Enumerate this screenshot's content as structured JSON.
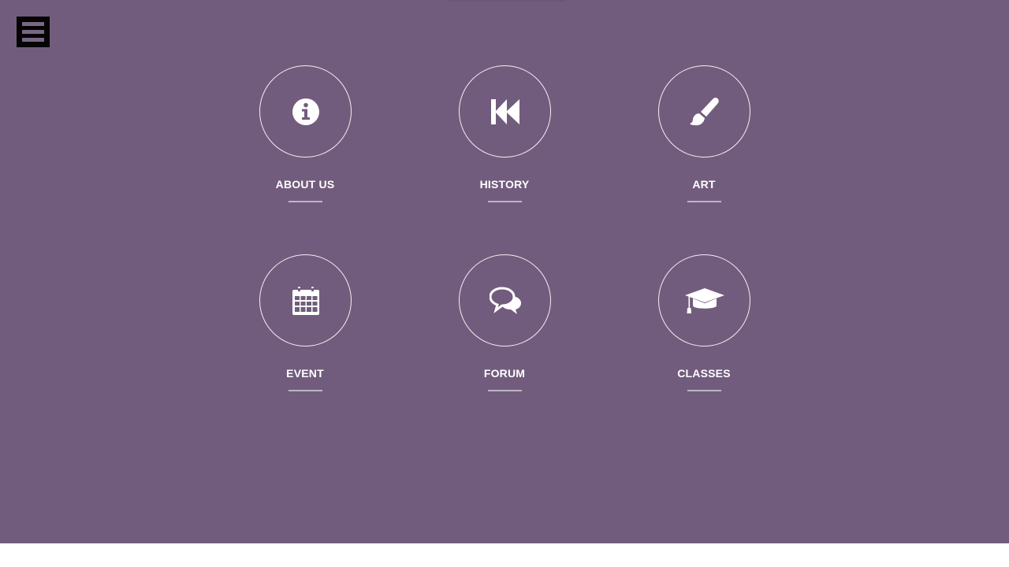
{
  "header": {
    "menu_icon": "hamburger-menu-icon"
  },
  "tiles": [
    {
      "label": "ABOUT US",
      "icon": "info-icon"
    },
    {
      "label": "HISTORY",
      "icon": "fast-backward-icon"
    },
    {
      "label": "ART",
      "icon": "paintbrush-icon"
    },
    {
      "label": "EVENT",
      "icon": "calendar-icon"
    },
    {
      "label": "FORUM",
      "icon": "chat-bubbles-icon"
    },
    {
      "label": "CLASSES",
      "icon": "graduation-cap-icon"
    }
  ],
  "colors": {
    "background": "#725c7d",
    "menu_button": "#050505",
    "text": "#ffffff"
  }
}
